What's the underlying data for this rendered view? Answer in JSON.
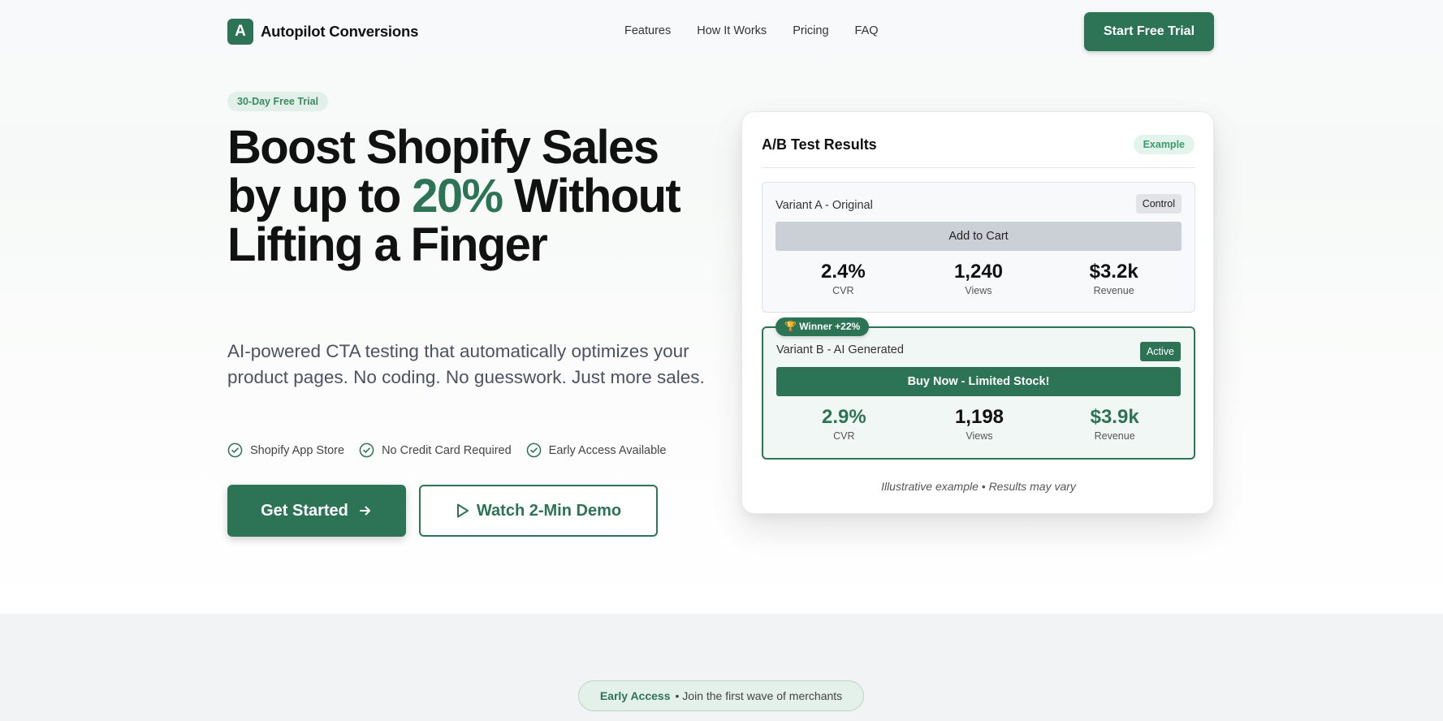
{
  "brand": {
    "logo_letter": "A",
    "name": "Autopilot Conversions"
  },
  "nav": {
    "links": [
      "Features",
      "How It Works",
      "Pricing",
      "FAQ"
    ],
    "cta": "Start Free Trial"
  },
  "hero": {
    "badge": "30-Day Free Trial",
    "headline_part1": "Boost Shopify Sales by up to ",
    "headline_accent": "20%",
    "headline_part2": " Without Lifting a Finger",
    "subhead": "AI-powered CTA testing that automatically optimizes your product pages. No coding. No guesswork. Just more sales.",
    "trust": [
      "Shopify App Store",
      "No Credit Card Required",
      "Early Access Available"
    ],
    "primary_cta": "Get Started",
    "secondary_cta": "Watch 2-Min Demo"
  },
  "card": {
    "title": "A/B Test Results",
    "badge": "Example",
    "variant_a": {
      "name": "Variant A - Original",
      "tag": "Control",
      "cta": "Add to Cart",
      "stats": [
        {
          "value": "2.4%",
          "label": "CVR"
        },
        {
          "value": "1,240",
          "label": "Views"
        },
        {
          "value": "$3.2k",
          "label": "Revenue"
        }
      ]
    },
    "variant_b": {
      "winner": "🏆 Winner +22%",
      "name": "Variant B - AI Generated",
      "tag": "Active",
      "cta": "Buy Now - Limited Stock!",
      "stats": [
        {
          "value": "2.9%",
          "label": "CVR"
        },
        {
          "value": "1,198",
          "label": "Views"
        },
        {
          "value": "$3.9k",
          "label": "Revenue"
        }
      ]
    },
    "footnote": "Illustrative example • Results may vary"
  },
  "early_access": {
    "label": "Early Access",
    "text": "• Join the first wave of merchants"
  },
  "colors": {
    "accent": "#2d7456",
    "accent_light": "#e3f0e9",
    "text": "#111111",
    "muted": "#4b5360"
  }
}
